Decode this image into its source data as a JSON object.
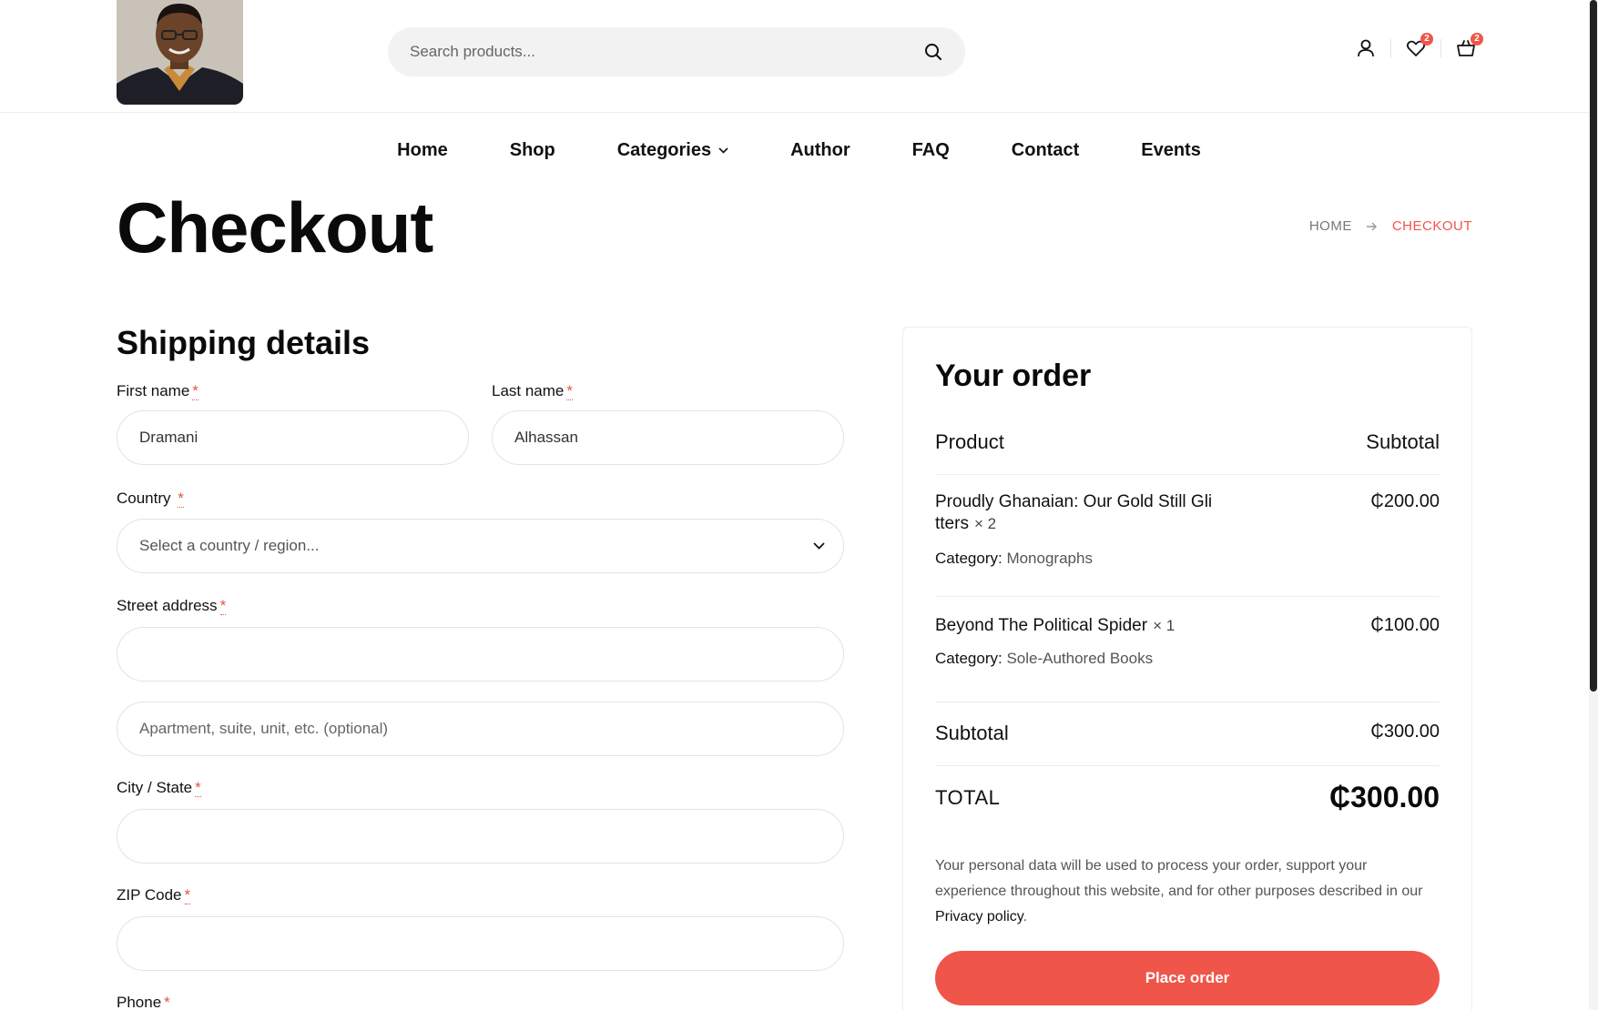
{
  "header": {
    "search": {
      "placeholder": "Search products..."
    },
    "wishlist_count": "2",
    "cart_count": "2",
    "icons": [
      "user-icon",
      "heart-icon",
      "cart-icon",
      "search-icon"
    ]
  },
  "nav": {
    "items": [
      "Home",
      "Shop",
      "Categories",
      "Author",
      "FAQ",
      "Contact",
      "Events"
    ]
  },
  "page": {
    "title": "Checkout",
    "breadcrumb": {
      "home": "HOME",
      "current": "CHECKOUT"
    }
  },
  "shipping": {
    "title": "Shipping details",
    "required_mark": "*",
    "first_name": {
      "label": "First name",
      "value": "Dramani"
    },
    "last_name": {
      "label": "Last name",
      "value": "Alhassan"
    },
    "country": {
      "label": "Country",
      "placeholder": "Select a country / region..."
    },
    "street": {
      "label": "Street address",
      "value": ""
    },
    "apartment": {
      "placeholder": "Apartment, suite, unit, etc. (optional)"
    },
    "city": {
      "label": "City / State",
      "value": ""
    },
    "zip": {
      "label": "ZIP Code",
      "value": ""
    },
    "phone": {
      "label": "Phone"
    }
  },
  "order": {
    "title": "Your order",
    "col_product": "Product",
    "col_subtotal": "Subtotal",
    "items": [
      {
        "name": "Proudly Ghanaian: Our Gold Still Gli tters",
        "qty": "× 2",
        "price": "₵200.00",
        "category_label": "Category:",
        "category": "Monographs"
      },
      {
        "name": "Beyond The Political Spider",
        "qty": "× 1",
        "price": "₵100.00",
        "category_label": "Category:",
        "category": "Sole-Authored Books"
      }
    ],
    "subtotal_label": "Subtotal",
    "subtotal_value": "₵300.00",
    "total_label": "TOTAL",
    "total_value": "₵300.00",
    "privacy_text": "Your personal data will be used to process your order, support your experience throughout this website, and for other purposes described in our ",
    "privacy_link": "Privacy policy",
    "privacy_end": ".",
    "place_order": "Place order"
  },
  "colors": {
    "accent": "#f0554a",
    "text": "#111111",
    "muted": "#555555",
    "border": "#e3e3e3"
  }
}
